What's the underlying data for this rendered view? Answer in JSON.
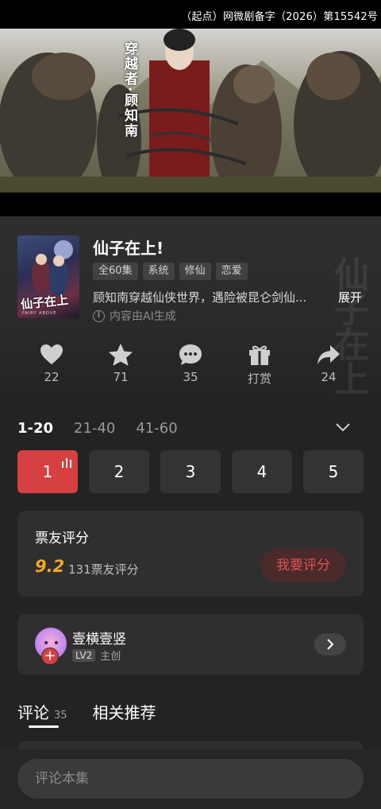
{
  "license_text": "（起点）网微剧备字（2026）第15542号",
  "video": {
    "caption": "穿越者·顾知南"
  },
  "drama": {
    "poster_title": "仙子在上",
    "poster_subtitle": "FAIRY ABOVE",
    "title": "仙子在上!",
    "tags": [
      "全60集",
      "系统",
      "修仙",
      "恋爱"
    ],
    "synopsis": "顾知南穿越仙侠世界，遇险被昆仑剑仙...",
    "expand_label": "展开",
    "ai_note": "内容由AI生成"
  },
  "actions": [
    {
      "icon": "heart-icon",
      "label": "22"
    },
    {
      "icon": "star-icon",
      "label": "71"
    },
    {
      "icon": "comment-icon",
      "label": "35"
    },
    {
      "icon": "gift-icon",
      "label": "打赏"
    },
    {
      "icon": "share-icon",
      "label": "24"
    }
  ],
  "episode_ranges": [
    "1-20",
    "21-40",
    "41-60"
  ],
  "episodes": [
    "1",
    "2",
    "3",
    "4",
    "5"
  ],
  "rating": {
    "title": "票友评分",
    "score": "9.2",
    "count": "131票友评分",
    "button": "我要评分"
  },
  "author": {
    "name": "壹横壹竖",
    "level": "LV2",
    "role": "主创"
  },
  "bottom_tabs": {
    "comments_label": "评论",
    "comments_count": "35",
    "related_label": "相关推荐"
  },
  "comment_placeholder": "评论本集",
  "colors": {
    "accent": "#d74040",
    "score": "#f5a623",
    "background": "#232323",
    "card": "#2f2f2f"
  }
}
